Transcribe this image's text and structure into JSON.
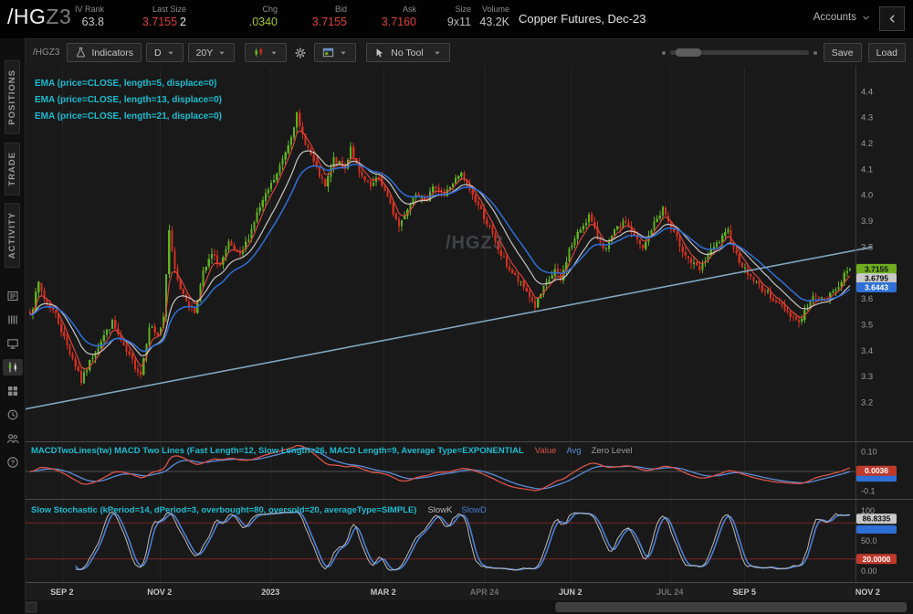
{
  "header": {
    "symbol_main": "/HG",
    "symbol_suffix": "Z3",
    "fields": [
      {
        "label": "IV Rank",
        "value": "63.8",
        "color": "#c9c9c9"
      },
      {
        "label": "Last Size",
        "value": "3.7155",
        "extra": "2",
        "color": "#e0403a"
      },
      {
        "label": "Chg",
        "value": ".0340",
        "color": "#a6c52f"
      },
      {
        "label": "Bid",
        "value": "3.7155",
        "color": "#e0403a"
      },
      {
        "label": "Ask",
        "value": "3.7160",
        "color": "#e0403a"
      },
      {
        "label": "Size",
        "value": "9x11",
        "color": "#b8b8b8"
      },
      {
        "label": "Volume",
        "value": "43.2K",
        "color": "#c9c9c9"
      }
    ],
    "description": "Copper Futures, Dec-23",
    "accounts_label": "Accounts",
    "accounts_icon": "chevron-down-icon",
    "collapse_icon": "chevron-left-icon"
  },
  "sidebar": {
    "tabs": [
      {
        "label": "POSITIONS"
      },
      {
        "label": "TRADE"
      },
      {
        "label": "ACTIVITY"
      }
    ],
    "icons": [
      {
        "name": "news-icon"
      },
      {
        "name": "ladder-icon"
      },
      {
        "name": "monitor-icon"
      },
      {
        "name": "chart-icon",
        "active": true
      },
      {
        "name": "grid-icon"
      },
      {
        "name": "clock-icon"
      },
      {
        "name": "people-icon"
      },
      {
        "name": "help-icon"
      }
    ]
  },
  "toolbar": {
    "symbol_label": "/HGZ3",
    "indicators_icon": "flask-icon",
    "indicators_label": "Indicators",
    "period_value": "D",
    "range_value": "20Y",
    "chart_type_icon": "candlestick-icon",
    "settings_icon": "gear-icon",
    "style_icon": "style-icon",
    "tool_icon": "cursor-icon",
    "tool_value": "No Tool",
    "save_label": "Save",
    "load_label": "Load"
  },
  "chart_data": {
    "type": "candlestick",
    "title": "/HGZ3 Copper Futures, Dec-23 - Daily, 20Y view with EMA(5), EMA(13), EMA(21), MACD Two Lines, Slow Stochastic",
    "watermark": "/HGZ3",
    "n_candles": 290,
    "ylim": [
      3.05,
      4.5
    ],
    "y_ticks": [
      3.2,
      3.3,
      3.4,
      3.5,
      3.6,
      3.7,
      3.8,
      3.9,
      4.0,
      4.1,
      4.2,
      4.3,
      4.4
    ],
    "x_labels": [
      {
        "text": "SEP 2",
        "f": 0.041,
        "dim": false
      },
      {
        "text": "NOV 2",
        "f": 0.151,
        "dim": false
      },
      {
        "text": "2023",
        "f": 0.276,
        "dim": false
      },
      {
        "text": "MAR 2",
        "f": 0.403,
        "dim": false
      },
      {
        "text": "APR 24",
        "f": 0.517,
        "dim": true
      },
      {
        "text": "JUN 2",
        "f": 0.614,
        "dim": false
      },
      {
        "text": "JUL 24",
        "f": 0.726,
        "dim": true
      },
      {
        "text": "SEP 5",
        "f": 0.81,
        "dim": false
      },
      {
        "text": "NOV 2",
        "f": 0.949,
        "dim": false
      }
    ],
    "last_price": 3.7155,
    "close_anchors": [
      [
        0,
        3.55
      ],
      [
        1,
        3.57
      ],
      [
        3,
        3.66
      ],
      [
        5,
        3.6
      ],
      [
        9,
        3.54
      ],
      [
        13,
        3.42
      ],
      [
        17,
        3.32
      ],
      [
        18,
        3.28
      ],
      [
        22,
        3.38
      ],
      [
        25,
        3.44
      ],
      [
        29,
        3.51
      ],
      [
        33,
        3.41
      ],
      [
        37,
        3.34
      ],
      [
        39,
        3.31
      ],
      [
        42,
        3.5
      ],
      [
        45,
        3.46
      ],
      [
        47,
        3.52
      ],
      [
        49,
        3.86
      ],
      [
        51,
        3.72
      ],
      [
        54,
        3.61
      ],
      [
        58,
        3.55
      ],
      [
        61,
        3.7
      ],
      [
        64,
        3.77
      ],
      [
        67,
        3.73
      ],
      [
        70,
        3.81
      ],
      [
        74,
        3.76
      ],
      [
        77,
        3.84
      ],
      [
        80,
        3.93
      ],
      [
        84,
        4.02
      ],
      [
        87,
        4.08
      ],
      [
        91,
        4.2
      ],
      [
        94,
        4.31
      ],
      [
        95,
        4.26
      ],
      [
        98,
        4.18
      ],
      [
        101,
        4.1
      ],
      [
        104,
        4.03
      ],
      [
        107,
        4.14
      ],
      [
        111,
        4.1
      ],
      [
        113,
        4.19
      ],
      [
        116,
        4.08
      ],
      [
        120,
        4.03
      ],
      [
        123,
        4.07
      ],
      [
        127,
        3.96
      ],
      [
        130,
        3.88
      ],
      [
        133,
        3.95
      ],
      [
        136,
        4.01
      ],
      [
        140,
        3.99
      ],
      [
        143,
        4.04
      ],
      [
        146,
        4.0
      ],
      [
        149,
        4.05
      ],
      [
        152,
        4.08
      ],
      [
        156,
        4.0
      ],
      [
        159,
        3.94
      ],
      [
        162,
        3.87
      ],
      [
        165,
        3.79
      ],
      [
        168,
        3.73
      ],
      [
        172,
        3.67
      ],
      [
        175,
        3.63
      ],
      [
        178,
        3.57
      ],
      [
        181,
        3.64
      ],
      [
        185,
        3.71
      ],
      [
        187,
        3.67
      ],
      [
        190,
        3.79
      ],
      [
        194,
        3.87
      ],
      [
        197,
        3.92
      ],
      [
        200,
        3.84
      ],
      [
        203,
        3.79
      ],
      [
        206,
        3.86
      ],
      [
        210,
        3.9
      ],
      [
        213,
        3.84
      ],
      [
        216,
        3.79
      ],
      [
        219,
        3.87
      ],
      [
        223,
        3.95
      ],
      [
        226,
        3.87
      ],
      [
        230,
        3.79
      ],
      [
        233,
        3.74
      ],
      [
        236,
        3.71
      ],
      [
        239,
        3.77
      ],
      [
        242,
        3.81
      ],
      [
        246,
        3.86
      ],
      [
        249,
        3.77
      ],
      [
        252,
        3.71
      ],
      [
        256,
        3.66
      ],
      [
        261,
        3.61
      ],
      [
        266,
        3.56
      ],
      [
        271,
        3.51
      ],
      [
        274,
        3.57
      ],
      [
        277,
        3.62
      ],
      [
        280,
        3.59
      ],
      [
        284,
        3.64
      ],
      [
        287,
        3.69
      ],
      [
        289,
        3.7155
      ]
    ],
    "overlays": [
      {
        "label": "EMA (price=CLOSE, length=5, displace=0)",
        "length": 5,
        "color": "#df4639"
      },
      {
        "label": "EMA (price=CLOSE, length=13, displace=0)",
        "length": 13,
        "color": "#cfcfcf"
      },
      {
        "label": "EMA (price=CLOSE, length=21, displace=0)",
        "length": 21,
        "color": "#2f6fd6"
      }
    ],
    "price_bubbles": [
      {
        "text": "3.7155",
        "price": 3.7155,
        "bg": "#6fae1f",
        "fg": "#0c0c0c"
      },
      {
        "text": "3.6795",
        "price": 3.6795,
        "bg": "#c9c9c9",
        "fg": "#0c0c0c"
      },
      {
        "text": "3.6443",
        "price": 3.6443,
        "bg": "#2f6fd6",
        "fg": "#ffffff"
      }
    ],
    "trendline": {
      "x1_f": 0.0,
      "p1": 3.175,
      "x2_f": 1.02,
      "p2": 3.8,
      "color": "#7fa6bf"
    },
    "colors": {
      "up": "#61b01e",
      "down": "#cf2f20",
      "bg": "#191919",
      "grid": "#242927",
      "axis_text": "#9a9a9a",
      "label": "#1bbcd0",
      "watermark": "#3f4346",
      "separator": "#4a4a4a",
      "zero_line": "#4f4f4f",
      "ob_os_line": "#7e2222"
    },
    "macd": {
      "label": "MACDTwoLines(tw) MACD Two Lines (Fast Length=12, Slow Length=26, MACD Length=9, Average Type=EXPONENTIAL",
      "legend": [
        {
          "text": "Value",
          "color": "#d9534a"
        },
        {
          "text": "Avg",
          "color": "#5b8cd8"
        },
        {
          "text": "Zero Level",
          "color": "#9a9a9a"
        }
      ],
      "fast_length": 12,
      "slow_length": 26,
      "macd_length": 9,
      "ylim": [
        -0.14,
        0.14
      ],
      "ticks": [
        {
          "v": 0.1,
          "text": "0.10"
        },
        {
          "v": -0.1,
          "text": "-0.1"
        }
      ],
      "value_bubble": {
        "text": "0.0036",
        "bg": "#c0392b",
        "fg": "#ffffff",
        "v": 0.0036
      },
      "avg_bubble": {
        "bg": "#2f6fd6",
        "v": -0.012
      }
    },
    "stoch": {
      "label": "Slow Stochastic (kPeriod=14, dPeriod=3, overbought=80, oversold=20, averageType=SIMPLE)",
      "legend": [
        {
          "text": "SlowK",
          "color": "#b9b9b9"
        },
        {
          "text": "SlowD",
          "color": "#4a7ed2"
        }
      ],
      "k_period": 14,
      "d_period": 3,
      "overbought": 80,
      "oversold": 20,
      "ticks": [
        {
          "v": 100,
          "text": "100"
        },
        {
          "v": 50,
          "text": "50.0"
        },
        {
          "v": 0,
          "text": "0.00"
        }
      ],
      "slowk_bubble": {
        "text": "86.8335",
        "bg": "#c9c9c9",
        "fg": "#0c0c0c",
        "v": 86.8
      },
      "slowd_bubble": {
        "bg": "#2f6fd6",
        "v": 78.0
      },
      "oversold_bubble": {
        "text": "20.0000",
        "bg": "#c0392b",
        "fg": "#ffffff",
        "v": 20
      }
    },
    "scrollbar": {
      "handle_from_f": 0.597,
      "handle_to_f": 0.993
    }
  }
}
